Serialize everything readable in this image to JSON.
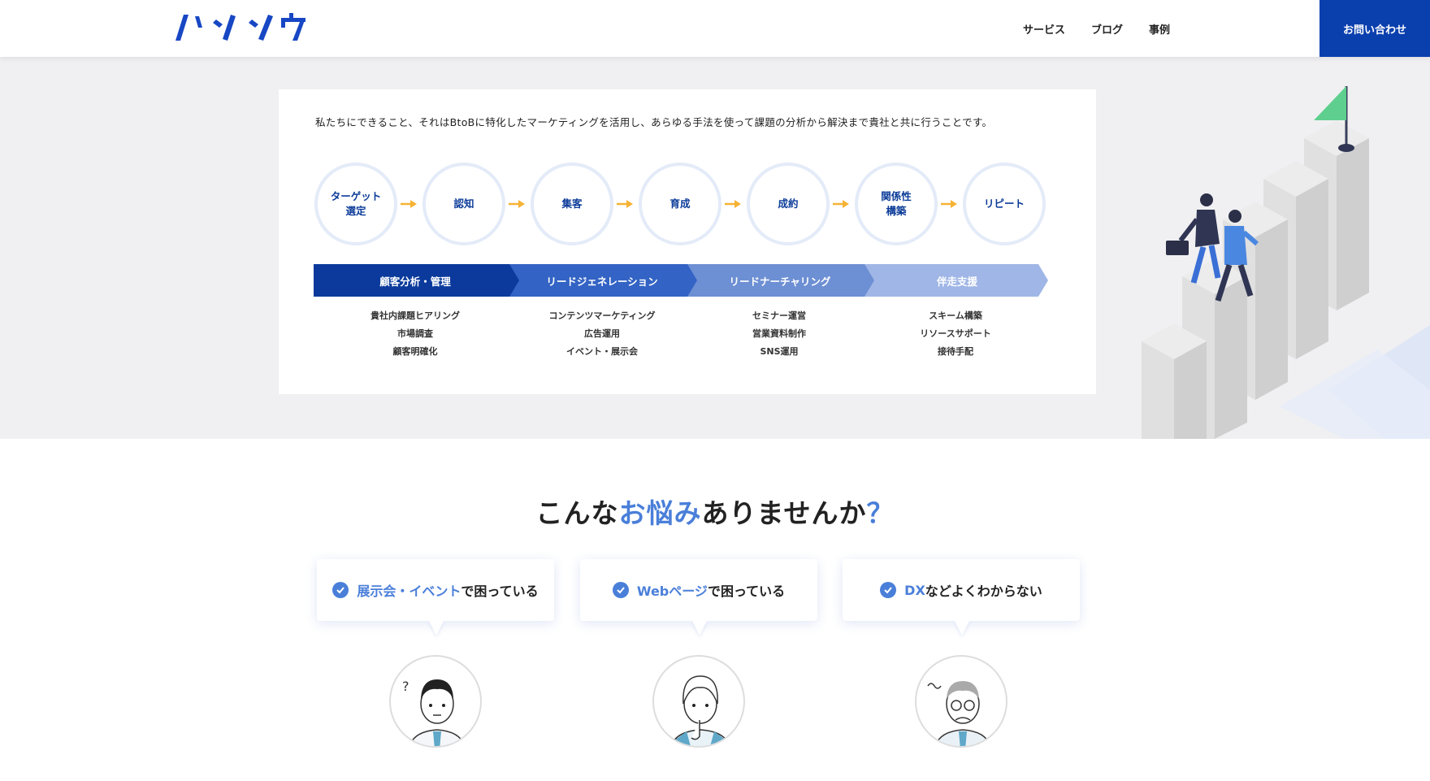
{
  "header": {
    "logo_text": "バンソウ",
    "nav": [
      "サービス",
      "ブログ",
      "事例"
    ],
    "contact_label": "お問い合わせ",
    "brand_color": "#0a3fae"
  },
  "intro": "私たちにできること、それはBtoBに特化したマーケティングを活用し、あらゆる手法を使って課題の分析から解決まで貴社と共に行うことです。",
  "steps": [
    "ターゲット\n選定",
    "認知",
    "集客",
    "育成",
    "成約",
    "関係性\n構築",
    "リピート"
  ],
  "phases": [
    {
      "label": "顧客分析・管理",
      "color": "#0b3a9c",
      "tasks": [
        "貴社内課題ヒアリング",
        "市場調査",
        "顧客明確化"
      ]
    },
    {
      "label": "リードジェネレーション",
      "color": "#3363c4",
      "tasks": [
        "コンテンツマーケティング",
        "広告運用",
        "イベント・展示会"
      ]
    },
    {
      "label": "リードナーチャリング",
      "color": "#6d8fd3",
      "tasks": [
        "セミナー運営",
        "営業資料制作",
        "SNS運用"
      ]
    },
    {
      "label": "伴走支援",
      "color": "#9fb6e6",
      "tasks": [
        "スキーム構築",
        "リソースサポート",
        "接待手配"
      ]
    }
  ],
  "heading": {
    "prefix": "こんな",
    "accent": "お悩み",
    "suffix": "ありませんか",
    "mark": "？"
  },
  "concerns": [
    {
      "accent": "展示会・イベント",
      "rest": "で困っている"
    },
    {
      "accent": "Webページ",
      "rest": "で困っている"
    },
    {
      "accent": "DX",
      "rest": "などよくわからない"
    }
  ]
}
